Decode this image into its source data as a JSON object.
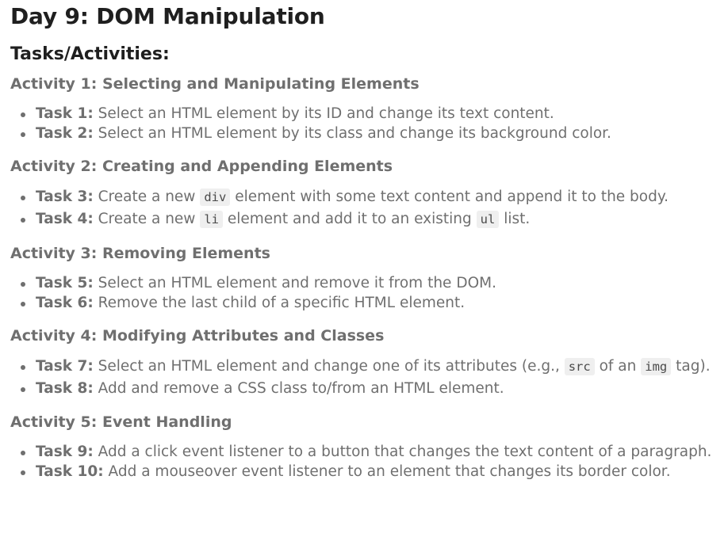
{
  "title": "Day 9: DOM Manipulation",
  "subtitle": "Tasks/Activities:",
  "activities": [
    {
      "heading": "Activity 1: Selecting and Manipulating Elements",
      "tasks": [
        {
          "name": "Task 1:",
          "text": " Select an HTML element by its ID and change its text content."
        },
        {
          "name": "Task 2:",
          "text": " Select an HTML element by its class and change its background color."
        }
      ]
    },
    {
      "heading": "Activity 2: Creating and Appending Elements",
      "tasks": [
        {
          "name": "Task 3:",
          "pre": " Create a new ",
          "code": "div",
          "post": " element with some text content and append it to the body."
        },
        {
          "name": "Task 4:",
          "pre": " Create a new ",
          "code": "li",
          "mid": " element and add it to an existing ",
          "code2": "ul",
          "post": " list."
        }
      ]
    },
    {
      "heading": "Activity 3: Removing Elements",
      "tasks": [
        {
          "name": "Task 5:",
          "text": " Select an HTML element and remove it from the DOM."
        },
        {
          "name": "Task 6:",
          "text": " Remove the last child of a specific HTML element."
        }
      ]
    },
    {
      "heading": "Activity 4: Modifying Attributes and Classes",
      "tasks": [
        {
          "name": "Task 7:",
          "pre": " Select an HTML element and change one of its attributes (e.g., ",
          "code": "src",
          "mid": " of an ",
          "code2": "img",
          "post": " tag)."
        },
        {
          "name": "Task 8:",
          "text": " Add and remove a CSS class to/from an HTML element."
        }
      ]
    },
    {
      "heading": "Activity 5: Event Handling",
      "tasks": [
        {
          "name": "Task 9:",
          "text": " Add a click event listener to a button that changes the text content of a paragraph."
        },
        {
          "name": "Task 10:",
          "text": " Add a mouseover event listener to an element that changes its border color."
        }
      ]
    }
  ]
}
